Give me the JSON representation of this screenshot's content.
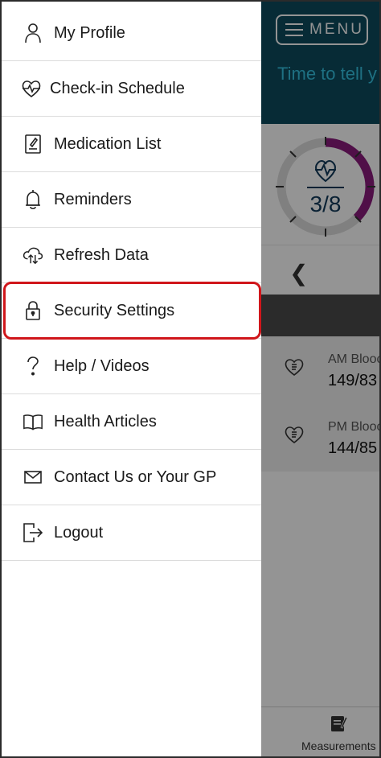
{
  "drawer": {
    "items": [
      {
        "label": "My Profile",
        "icon": "person-icon"
      },
      {
        "label": "Check-in Schedule",
        "icon": "heartbeat-icon"
      },
      {
        "label": "Medication List",
        "icon": "medication-list-icon"
      },
      {
        "label": "Reminders",
        "icon": "bell-icon"
      },
      {
        "label": "Refresh Data",
        "icon": "cloud-refresh-icon"
      },
      {
        "label": "Security Settings",
        "icon": "lock-icon"
      },
      {
        "label": "Help / Videos",
        "icon": "question-icon"
      },
      {
        "label": "Health Articles",
        "icon": "book-icon"
      },
      {
        "label": "Contact Us or Your GP",
        "icon": "envelope-icon"
      },
      {
        "label": "Logout",
        "icon": "logout-icon"
      }
    ],
    "highlighted_item": "Security Settings",
    "highlight_color": "#d0161b"
  },
  "background_app": {
    "menu_button_label": "MENU",
    "prompt_text": "Time to tell y doing",
    "progress": {
      "completed": 3,
      "total": 8,
      "label": "3/8"
    },
    "readings": [
      {
        "label": "AM Blooc",
        "value": "149/83"
      },
      {
        "label": "PM Blooc",
        "value": "144/85"
      }
    ],
    "bottom_tab_label": "Measurements"
  },
  "colors": {
    "header": "#0d4a5e",
    "prompt": "#35c2e0",
    "progress_arc": "#8a1a7c",
    "progress_track": "#dcdcdc"
  }
}
